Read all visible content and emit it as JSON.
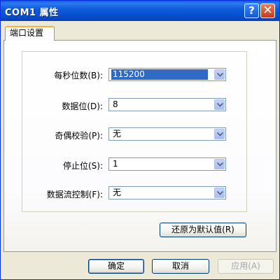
{
  "window": {
    "title": "COM1 属性",
    "help_glyph": "?",
    "close_glyph": "✕"
  },
  "tabs": [
    {
      "label": "端口设置",
      "active": true
    }
  ],
  "fields": {
    "baud_rate": {
      "label": "每秒位数(B):",
      "value": "115200"
    },
    "data_bits": {
      "label": "数据位(D):",
      "value": "8"
    },
    "parity": {
      "label": "奇偶校验(P):",
      "value": "无"
    },
    "stop_bits": {
      "label": "停止位(S):",
      "value": "1"
    },
    "flow_control": {
      "label": "数据流控制(F):",
      "value": "无"
    }
  },
  "buttons": {
    "restore_defaults": "还原为默认值(R)",
    "ok": "确定",
    "cancel": "取消",
    "apply": "应用(A)"
  },
  "colors": {
    "titlebar": "#0a5ae0",
    "selection": "#316ac5",
    "tab_highlight": "#f8b23a"
  }
}
